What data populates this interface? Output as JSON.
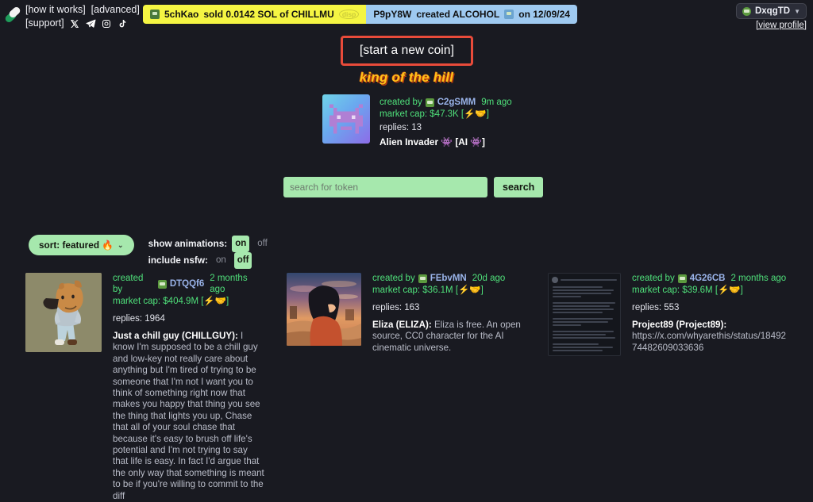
{
  "header": {
    "logo_icon": "pill-icon",
    "links": [
      {
        "label": "[how it works]"
      },
      {
        "label": "[advanced]"
      },
      {
        "label": "[support]"
      }
    ],
    "socials": [
      {
        "name": "x-twitter-icon"
      },
      {
        "name": "telegram-icon"
      },
      {
        "name": "instagram-icon"
      },
      {
        "name": "tiktok-icon"
      }
    ],
    "ticker": [
      {
        "user": "5chKao",
        "action": "sold 0.0142 SOL of CHILLMU",
        "tag": "disp",
        "bg": "#f5f543"
      },
      {
        "user": "P9pY8W",
        "action": "created ALCOHOL",
        "date": "on 12/09/24",
        "bg": "#9ec9f0"
      }
    ],
    "profile": {
      "name": "DxqgTD",
      "chevron": "chevron-down-icon",
      "view_profile": "[view profile]"
    }
  },
  "hero": {
    "start_new_coin": "[start a new coin]",
    "king_of_the_hill": "king of the hill",
    "border_color": "#e84b3a"
  },
  "king_card": {
    "thumb_icon": "space-invader-icon",
    "created_by_label": "created by",
    "creator": "C2gSMM",
    "age": "9m ago",
    "market_cap": "market cap: $47.3K [⚡🤝]",
    "replies": "replies: 13",
    "name": "Alien Invader 👾 [AI 👾]"
  },
  "search": {
    "placeholder": "search for token",
    "value": "",
    "button_label": "search"
  },
  "filters": {
    "sort_label": "sort: featured 🔥",
    "sort_chevron": "chevron-down-icon",
    "show_animations_label": "show animations:",
    "show_animations_on": "on",
    "show_animations_off": "off",
    "show_animations_state": "on",
    "include_nsfw_label": "include nsfw:",
    "include_nsfw_on": "on",
    "include_nsfw_off": "off",
    "include_nsfw_state": "off"
  },
  "coins": [
    {
      "created_by_label": "created by",
      "creator": "DTQQf6",
      "age": "2 months ago",
      "market_cap": "market cap: $404.9M [⚡🤝]",
      "replies": "replies: 1964",
      "title": "Just a chill guy (CHILLGUY):",
      "description": " I know I'm supposed to be a chill guy and low-key not really care about anything but I'm tired of trying to be someone that I'm not I want you to think of something right now that makes you happy that thing you see the thing that lights you up, Chase that all of your soul chase that because it's easy to brush off life's potential and I'm not trying to say that life is easy. In fact I'd argue that the only way that something is meant to be if you're willing to commit to the diff",
      "thumb": "chill-guy-dog-thumbnail"
    },
    {
      "created_by_label": "created by",
      "creator": "FEbvMN",
      "age": "20d ago",
      "market_cap": "market cap: $36.1M [⚡🤝]",
      "replies": "replies: 163",
      "title": "Eliza (ELIZA):",
      "description": " Eliza is free. An open source, CC0 character for the AI cinematic universe.",
      "thumb": "anime-desert-thumbnail"
    },
    {
      "created_by_label": "created by",
      "creator": "4G26CB",
      "age": "2 months ago",
      "market_cap": "market cap: $39.6M [⚡🤝]",
      "replies": "replies: 553",
      "title": "Project89 (Project89):",
      "description": " https://x.com/whyarethis/status/1849274482609033636",
      "thumb": "tweet-screenshot-thumbnail"
    }
  ]
}
